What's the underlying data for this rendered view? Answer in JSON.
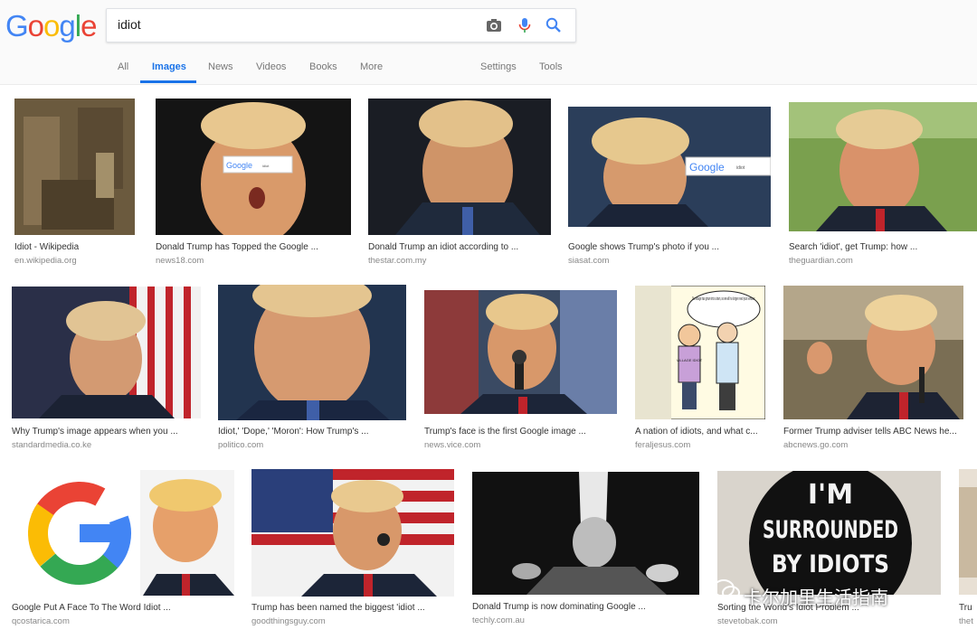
{
  "colors": {
    "google_blue": "#4285f4",
    "google_red": "#ea4335",
    "google_yellow": "#fbbc05",
    "google_green": "#34a853",
    "active_tab": "#1a73e8"
  },
  "logo": {
    "letters": [
      "G",
      "o",
      "o",
      "g",
      "l",
      "e"
    ]
  },
  "search": {
    "query": "idiot"
  },
  "icons": {
    "camera": "camera-icon",
    "mic": "mic-icon",
    "search": "search-icon"
  },
  "tabs": {
    "all": "All",
    "images": "Images",
    "news": "News",
    "videos": "Videos",
    "books": "Books",
    "more": "More",
    "settings": "Settings",
    "tools": "Tools"
  },
  "results": [
    {
      "caption": "Idiot - Wikipedia",
      "source": "en.wikipedia.org"
    },
    {
      "caption": "Donald Trump has Topped the Google ...",
      "source": "news18.com"
    },
    {
      "caption": "Donald Trump an idiot according to ...",
      "source": "thestar.com.my"
    },
    {
      "caption": "Google shows Trump's photo if you ...",
      "source": "siasat.com"
    },
    {
      "caption": "Search 'idiot', get Trump: how ...",
      "source": "theguardian.com"
    },
    {
      "caption": "Why Trump's image appears when you ...",
      "source": "standardmedia.co.ke"
    },
    {
      "caption": "Idiot,' 'Dope,' 'Moron': How Trump's ...",
      "source": "politico.com"
    },
    {
      "caption": "Trump's face is the first Google image ...",
      "source": "news.vice.com"
    },
    {
      "caption": "A nation of idiots, and what c...",
      "source": "feraljesus.com"
    },
    {
      "caption": "Former Trump adviser tells ABC News he...",
      "source": "abcnews.go.com"
    },
    {
      "caption": "Google Put A Face To The Word Idiot ...",
      "source": "qcostarica.com"
    },
    {
      "caption": "Trump has been named the biggest 'idiot ...",
      "source": "goodthingsguy.com"
    },
    {
      "caption": "Donald Trump is now dominating Google ...",
      "source": "techly.com.au"
    },
    {
      "caption": "Sorting the World's Idiot Problem ...",
      "source": "stevetobak.com"
    },
    {
      "caption": "Tru",
      "source": "thet"
    }
  ],
  "image_text": {
    "google_bar_logo": "Google",
    "google_bar_query": "idiot",
    "comic_bubble": "Our village has grown into a town, so we will no longer need your services.",
    "comic_shirt": "VILLAGE IDIOT",
    "button_line1": "I'M",
    "button_line2": "SURROUNDED",
    "button_line3": "BY IDIOTS"
  },
  "watermark": "卡尔加里生活指南"
}
